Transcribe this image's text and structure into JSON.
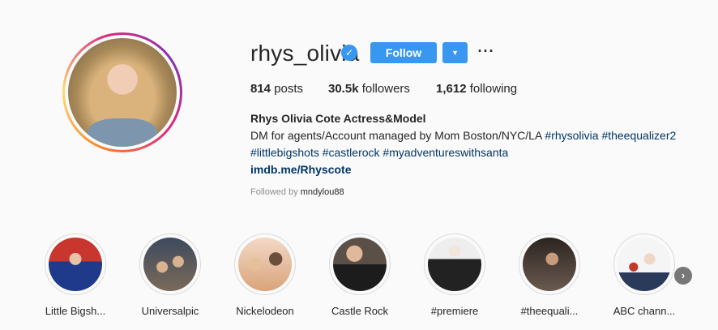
{
  "profile": {
    "username": "rhys_olivia",
    "follow_label": "Follow",
    "dropdown_icon": "chevron-down-icon",
    "more_icon": "more-horizontal-icon",
    "stats": {
      "posts_count": "814",
      "posts_label": " posts",
      "followers_count": "30.5k",
      "followers_label": " followers",
      "following_count": "1,612",
      "following_label": " following"
    },
    "bio": {
      "name": "Rhys Olivia Cote Actress&Model",
      "line1_text": "DM for agents/Account managed by Mom Boston/NYC/LA ",
      "line1_tags": [
        "#rhysolivia",
        "#theequalizer2"
      ],
      "line2_tags": [
        "#littlebigshots",
        "#castlerock",
        "#myadventureswithsanta"
      ],
      "link": "imdb.me/Rhyscote"
    },
    "followed_by_label": "Followed by ",
    "followed_by_name": "mndylou88"
  },
  "highlights": [
    {
      "label": "Little Bigsh...",
      "color": "#c8362e"
    },
    {
      "label": "Universalpic",
      "color": "#5b6b7a"
    },
    {
      "label": "Nickelodeon",
      "color": "#d9a47a"
    },
    {
      "label": "Castle Rock",
      "color": "#3a3a3a"
    },
    {
      "label": "#premiere",
      "color": "#4a4a4a"
    },
    {
      "label": "#theequali...",
      "color": "#6a5a50"
    },
    {
      "label": "ABC chann...",
      "color": "#b9a79b"
    }
  ],
  "colors": {
    "accent": "#3897f0",
    "tag": "#003569"
  }
}
